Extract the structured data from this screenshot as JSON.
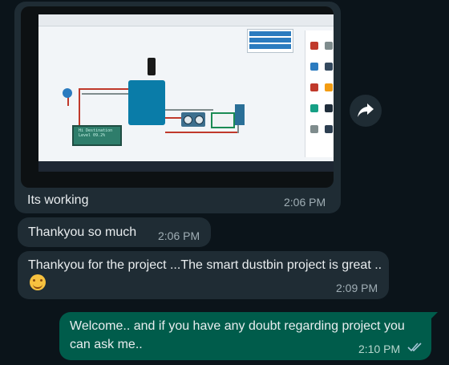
{
  "messages": [
    {
      "type": "image",
      "direction": "incoming",
      "caption": "Its working",
      "time": "2:06 PM",
      "photo": {
        "lcd_text_line1": "Hi Destination",
        "lcd_text_line2": "Level 09.2%"
      }
    },
    {
      "type": "text",
      "direction": "incoming",
      "text": "Thankyou so much",
      "time": "2:06 PM"
    },
    {
      "type": "text",
      "direction": "incoming",
      "text": "Thankyou for the project ...The smart dustbin project is great ..",
      "emoji": "smiling-face-emoji",
      "time": "2:09 PM"
    },
    {
      "type": "text",
      "direction": "outgoing",
      "text": "Welcome.. and if you have any doubt regarding project you can ask me..",
      "time": "2:10 PM",
      "status": "read"
    }
  ],
  "icons": {
    "forward": "forward-arrow-icon",
    "read_receipt": "double-check-icon"
  },
  "colors": {
    "background": "#0b141a",
    "incoming_bubble": "#1f2c34",
    "outgoing_bubble": "#005c4b",
    "read_tick": "#a7c8d8"
  }
}
